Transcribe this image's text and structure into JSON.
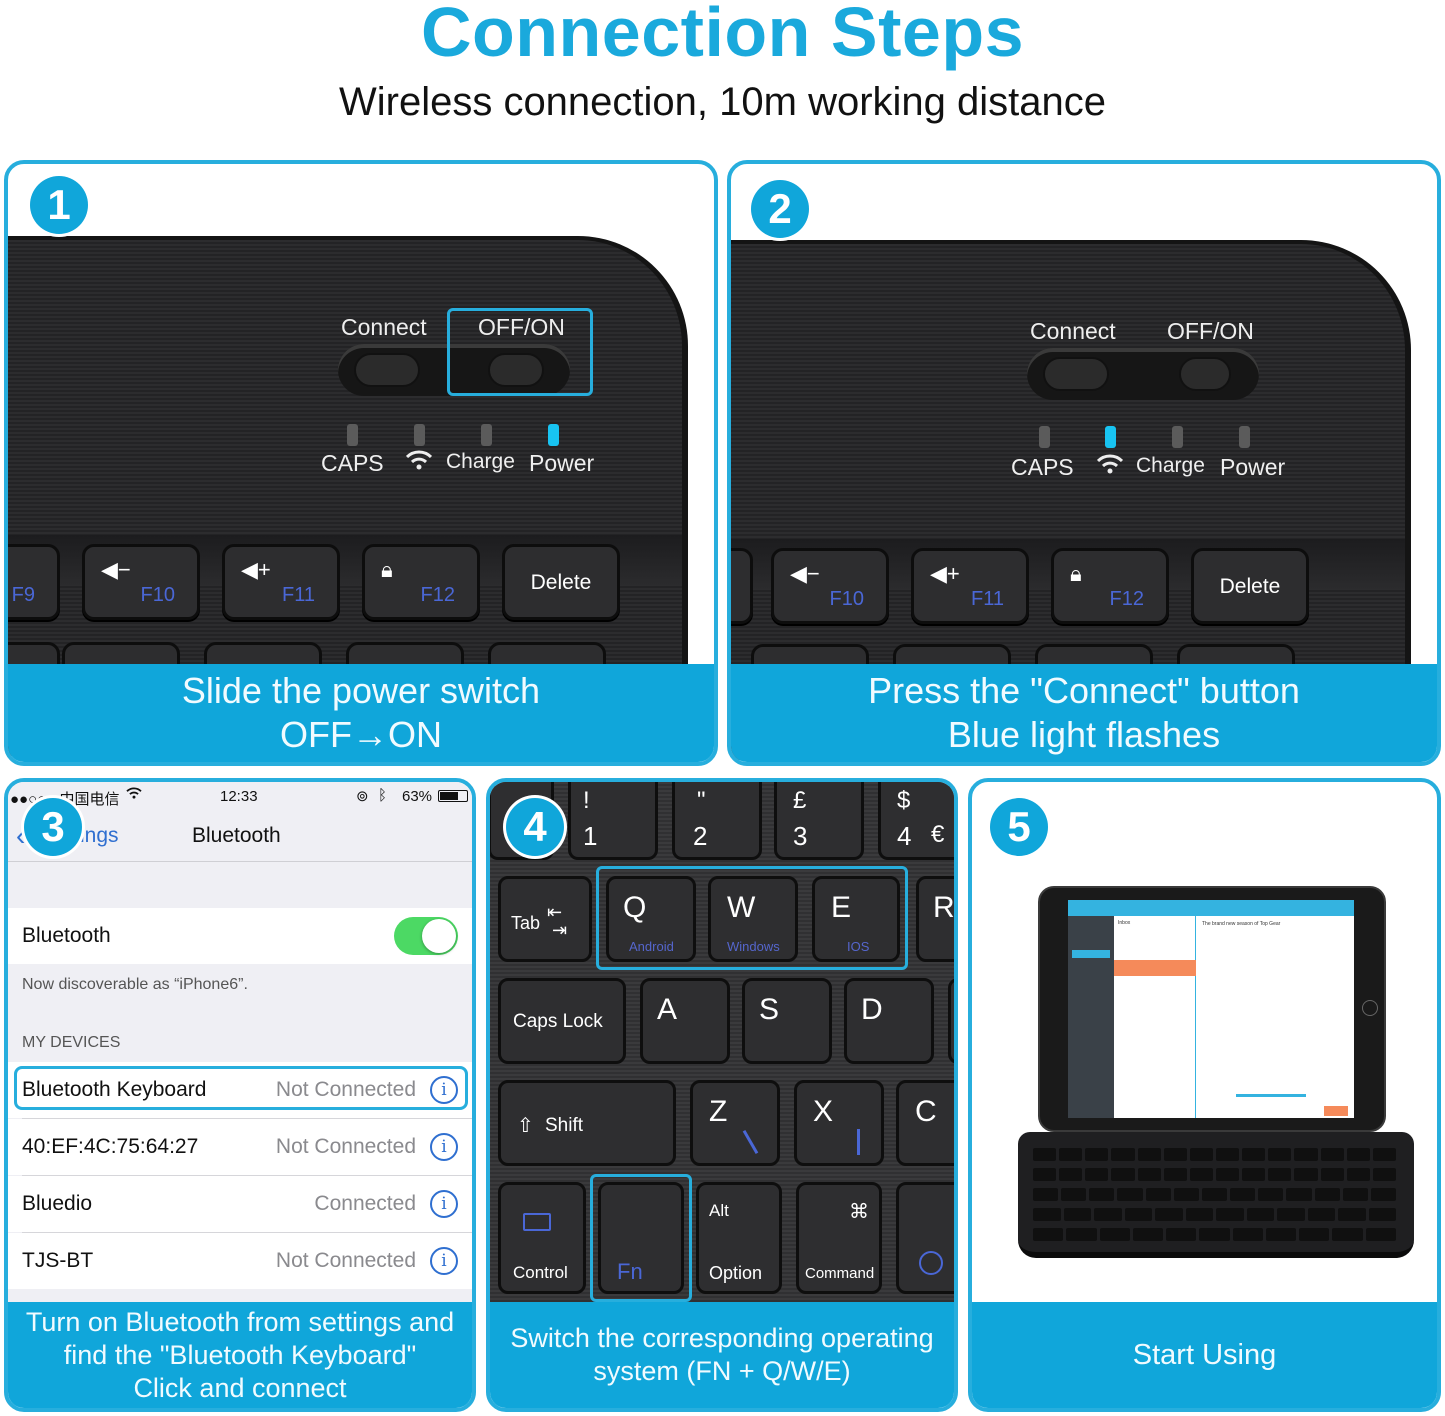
{
  "header": {
    "title": "Connection Steps",
    "subtitle": "Wireless connection, 10m working distance"
  },
  "colors": {
    "accent": "#10a6da",
    "border": "#27aedd",
    "led_on": "#18c4f2",
    "fn_blue": "#4a67d6",
    "ios_green": "#4cd964"
  },
  "steps": [
    {
      "number": "1",
      "caption": [
        "Slide the power switch",
        "OFF→ON"
      ],
      "switch_labels": {
        "connect": "Connect",
        "power": "OFF/ON"
      },
      "highlight": "OFF/ON",
      "leds": [
        {
          "label": "CAPS",
          "on": false
        },
        {
          "label": "wifi-icon",
          "on": false
        },
        {
          "label": "Charge",
          "on": false
        },
        {
          "label": "Power",
          "on": true
        }
      ],
      "keys": [
        {
          "icon": "",
          "fn": "F9"
        },
        {
          "icon": "volume-down-icon",
          "fn": "F10"
        },
        {
          "icon": "volume-up-icon",
          "fn": "F11"
        },
        {
          "icon": "lock-icon",
          "fn": "F12"
        },
        {
          "label": "Delete"
        }
      ]
    },
    {
      "number": "2",
      "caption": [
        "Press the \"Connect\" button",
        "Blue light flashes"
      ],
      "switch_labels": {
        "connect": "Connect",
        "power": "OFF/ON"
      },
      "leds": [
        {
          "label": "CAPS",
          "on": false
        },
        {
          "label": "wifi-icon",
          "on": true
        },
        {
          "label": "Charge",
          "on": false
        },
        {
          "label": "Power",
          "on": false
        }
      ],
      "keys": [
        {
          "icon": "volume-down-icon",
          "fn": "F10"
        },
        {
          "icon": "volume-up-icon",
          "fn": "F11"
        },
        {
          "icon": "lock-icon",
          "fn": "F12"
        },
        {
          "label": "Delete"
        }
      ]
    },
    {
      "number": "3",
      "caption": [
        "Turn on Bluetooth from settings and",
        "find the \"Bluetooth Keyboard\"",
        "Click and connect"
      ],
      "phone": {
        "status": {
          "carrier": "●●○○○ 中国电信",
          "time": "12:33",
          "battery": "63%"
        },
        "back_label": "ings",
        "nav_title": "Bluetooth",
        "bluetooth_label": "Bluetooth",
        "bluetooth_on": true,
        "discoverable": "Now discoverable as “iPhone6”.",
        "section_header": "MY DEVICES",
        "devices": [
          {
            "name": "Bluetooth Keyboard",
            "state": "Not Connected",
            "highlighted": true
          },
          {
            "name": "40:EF:4C:75:64:27",
            "state": "Not Connected"
          },
          {
            "name": "Bluedio",
            "state": "Connected"
          },
          {
            "name": "TJS-BT",
            "state": "Not Connected"
          }
        ]
      }
    },
    {
      "number": "4",
      "caption": [
        "Switch the corresponding operating",
        "system (FN + Q/W/E)"
      ],
      "keyboard": {
        "number_row": [
          {
            "top": "!",
            "bottom": "1"
          },
          {
            "top": "\"",
            "bottom": "2"
          },
          {
            "top": "£",
            "bottom": "3"
          },
          {
            "top": "$",
            "bottom": "4",
            "alt": "€"
          }
        ],
        "tab_label": "Tab",
        "os_keys": [
          {
            "key": "Q",
            "os": "Android"
          },
          {
            "key": "W",
            "os": "Windows"
          },
          {
            "key": "E",
            "os": "IOS"
          }
        ],
        "r_key": "R",
        "caps_label": "Caps Lock",
        "home_row": [
          "A",
          "S",
          "D"
        ],
        "shift_label": "Shift",
        "bottom_row_letters": [
          "Z",
          "X",
          "C"
        ],
        "control_label": "Control",
        "fn_label": "Fn",
        "alt_label": "Alt",
        "option_label": "Option",
        "command_symbol": "⌘",
        "command_label": "Command"
      }
    },
    {
      "number": "5",
      "caption": [
        "Start Using"
      ],
      "screen": {
        "inbox_label": "Inbox",
        "email_subject": "The brand new season of Top Gear"
      }
    }
  ]
}
